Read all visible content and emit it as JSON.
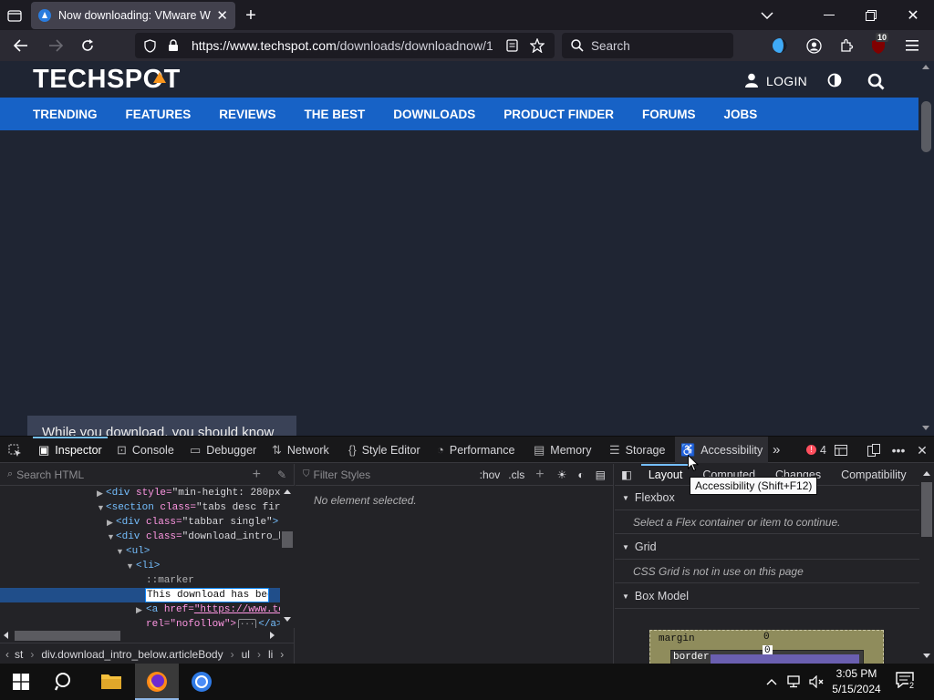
{
  "browser": {
    "tab_title": "Now downloading: VMware Wo",
    "url_host": "https://www.techspot.com",
    "url_path": "/downloads/downloadnow/1",
    "search_placeholder": "Search",
    "extension_badge": "10"
  },
  "site": {
    "logo": "TECHSPOT",
    "login_label": "LOGIN",
    "nav_items": [
      "TRENDING",
      "FEATURES",
      "REVIEWS",
      "THE BEST",
      "DOWNLOADS",
      "PRODUCT FINDER",
      "FORUMS",
      "JOBS"
    ],
    "know_box": "While you download, you should know"
  },
  "devtools": {
    "tabs": [
      "Inspector",
      "Console",
      "Debugger",
      "Network",
      "Style Editor",
      "Performance",
      "Memory",
      "Storage",
      "Accessibility"
    ],
    "error_count": "4",
    "tooltip": "Accessibility (Shift+F12)",
    "search_html_placeholder": "Search HTML",
    "filter_styles_placeholder": "Filter Styles",
    "hov": ":hov",
    "cls": ".cls",
    "no_element": "No element selected.",
    "layout_tabs": [
      "Layout",
      "Computed",
      "Changes",
      "Compatibility"
    ],
    "markup": [
      {
        "tag": "<div ",
        "attr": "style=",
        "val": "\"min-height: 280px\"",
        "tail": ">…"
      },
      {
        "tag": "<section ",
        "attr": "class=",
        "val": "\"tabs desc first\"",
        "tail": ""
      },
      {
        "tag": "<div ",
        "attr": "class=",
        "val": "\"tabbar single\"",
        "tail": ">"
      },
      {
        "tag": "<div ",
        "attr": "class=",
        "val": "\"download_intro_bel",
        "tail": ""
      },
      {
        "tag": "<ul>",
        "attr": "",
        "val": "",
        "tail": ""
      },
      {
        "tag": "<li>",
        "attr": "",
        "val": "",
        "tail": ""
      }
    ],
    "marker": "::marker",
    "edit_text": "This download has been",
    "link_line_tag": "<a ",
    "link_line_attr": "href=",
    "link_line_val": "\"https://www.tech",
    "rel_line": "rel=\"nofollow\">",
    "rel_close": "</a>",
    "breadcrumbs": [
      "st",
      "div.download_intro_below.articleBody",
      "ul",
      "li"
    ],
    "sections": [
      {
        "title": "Flexbox",
        "body": "Select a Flex container or item to continue."
      },
      {
        "title": "Grid",
        "body": "CSS Grid is not in use on this page"
      },
      {
        "title": "Box Model",
        "body": ""
      }
    ],
    "box_model": {
      "margin_label": "margin",
      "margin_value": "0",
      "border_label": "border",
      "border_value": "0"
    }
  },
  "taskbar": {
    "time": "3:05 PM",
    "date": "5/15/2024",
    "notif_count": "2"
  },
  "colors": {
    "accent_nav": "#1762c6",
    "page_bg": "#1f2533",
    "devtools_sel": "#75bfff"
  }
}
